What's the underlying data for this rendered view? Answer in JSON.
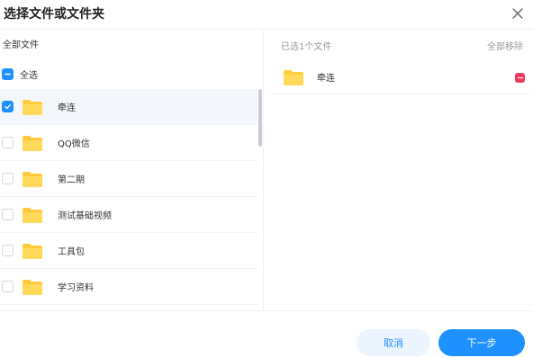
{
  "dialog": {
    "title": "选择文件或文件夹",
    "close_icon": "close-icon"
  },
  "left_panel": {
    "header": "全部文件",
    "select_all": {
      "label": "全选",
      "state": "indeterminate"
    },
    "items": [
      {
        "name": "牵连",
        "checked": true,
        "icon": "folder-icon"
      },
      {
        "name": "QQ微信",
        "checked": false,
        "icon": "folder-icon"
      },
      {
        "name": "第二期",
        "checked": false,
        "icon": "folder-icon"
      },
      {
        "name": "测试基础视频",
        "checked": false,
        "icon": "folder-icon"
      },
      {
        "name": "工具包",
        "checked": false,
        "icon": "folder-icon"
      },
      {
        "name": "学习资料",
        "checked": false,
        "icon": "folder-icon"
      }
    ]
  },
  "right_panel": {
    "header": "已选1个文件",
    "remove_all": "全部移除",
    "items": [
      {
        "name": "牵连",
        "icon": "folder-icon"
      }
    ]
  },
  "footer": {
    "cancel_label": "取消",
    "next_label": "下一步"
  },
  "colors": {
    "accent": "#1e90ff",
    "accent_light": "#ecf4fd",
    "remove_red": "#ee3d5f",
    "folder_yellow": "#ffcb3d"
  }
}
